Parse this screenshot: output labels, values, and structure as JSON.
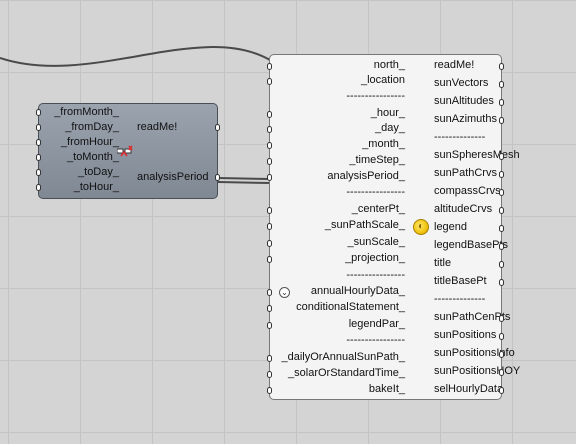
{
  "small_component": {
    "inputs": [
      "_fromMonth_",
      "_fromDay_",
      "_fromHour_",
      "_toMonth_",
      "_toDay_",
      "_toHour_"
    ],
    "outputs": [
      "readMe!",
      "analysisPeriod"
    ]
  },
  "big_component": {
    "inputs": [
      "north_",
      "_location",
      "----------------",
      "_hour_",
      "_day_",
      "_month_",
      "_timeStep_",
      "analysisPeriod_",
      "----------------",
      "_centerPt_",
      "_sunPathScale_",
      "_sunScale_",
      "_projection_",
      "----------------",
      "annualHourlyData_",
      "conditionalStatement_",
      "legendPar_",
      "----------------",
      "_dailyOrAnnualSunPath_",
      "_solarOrStandardTime_",
      "bakeIt_"
    ],
    "outputs": [
      "readMe!",
      "sunVectors",
      "sunAltitudes",
      "sunAzimuths",
      "--------------",
      "sunSpheresMesh",
      "sunPathCrvs",
      "compassCrvs",
      "altitudeCrvs",
      "legend",
      "legendBasePts",
      "title",
      "titleBasePt",
      "--------------",
      "sunPathCenPts",
      "sunPositions",
      "sunPositionsInfo",
      "sunPositionsHOY",
      "selHourlyData"
    ]
  },
  "colors": {
    "canvas": "#d4d4d4",
    "grid": "#c4c4c4",
    "small_body": "#8a929c",
    "big_body": "#f4f4f4",
    "wire": "#4a4a4a",
    "warning": "#e0262b",
    "legend_badge": "#f1c40f"
  },
  "icons": {
    "warning": "warning-icon",
    "legend": "legend-badge-icon",
    "annual": "expand-icon"
  }
}
